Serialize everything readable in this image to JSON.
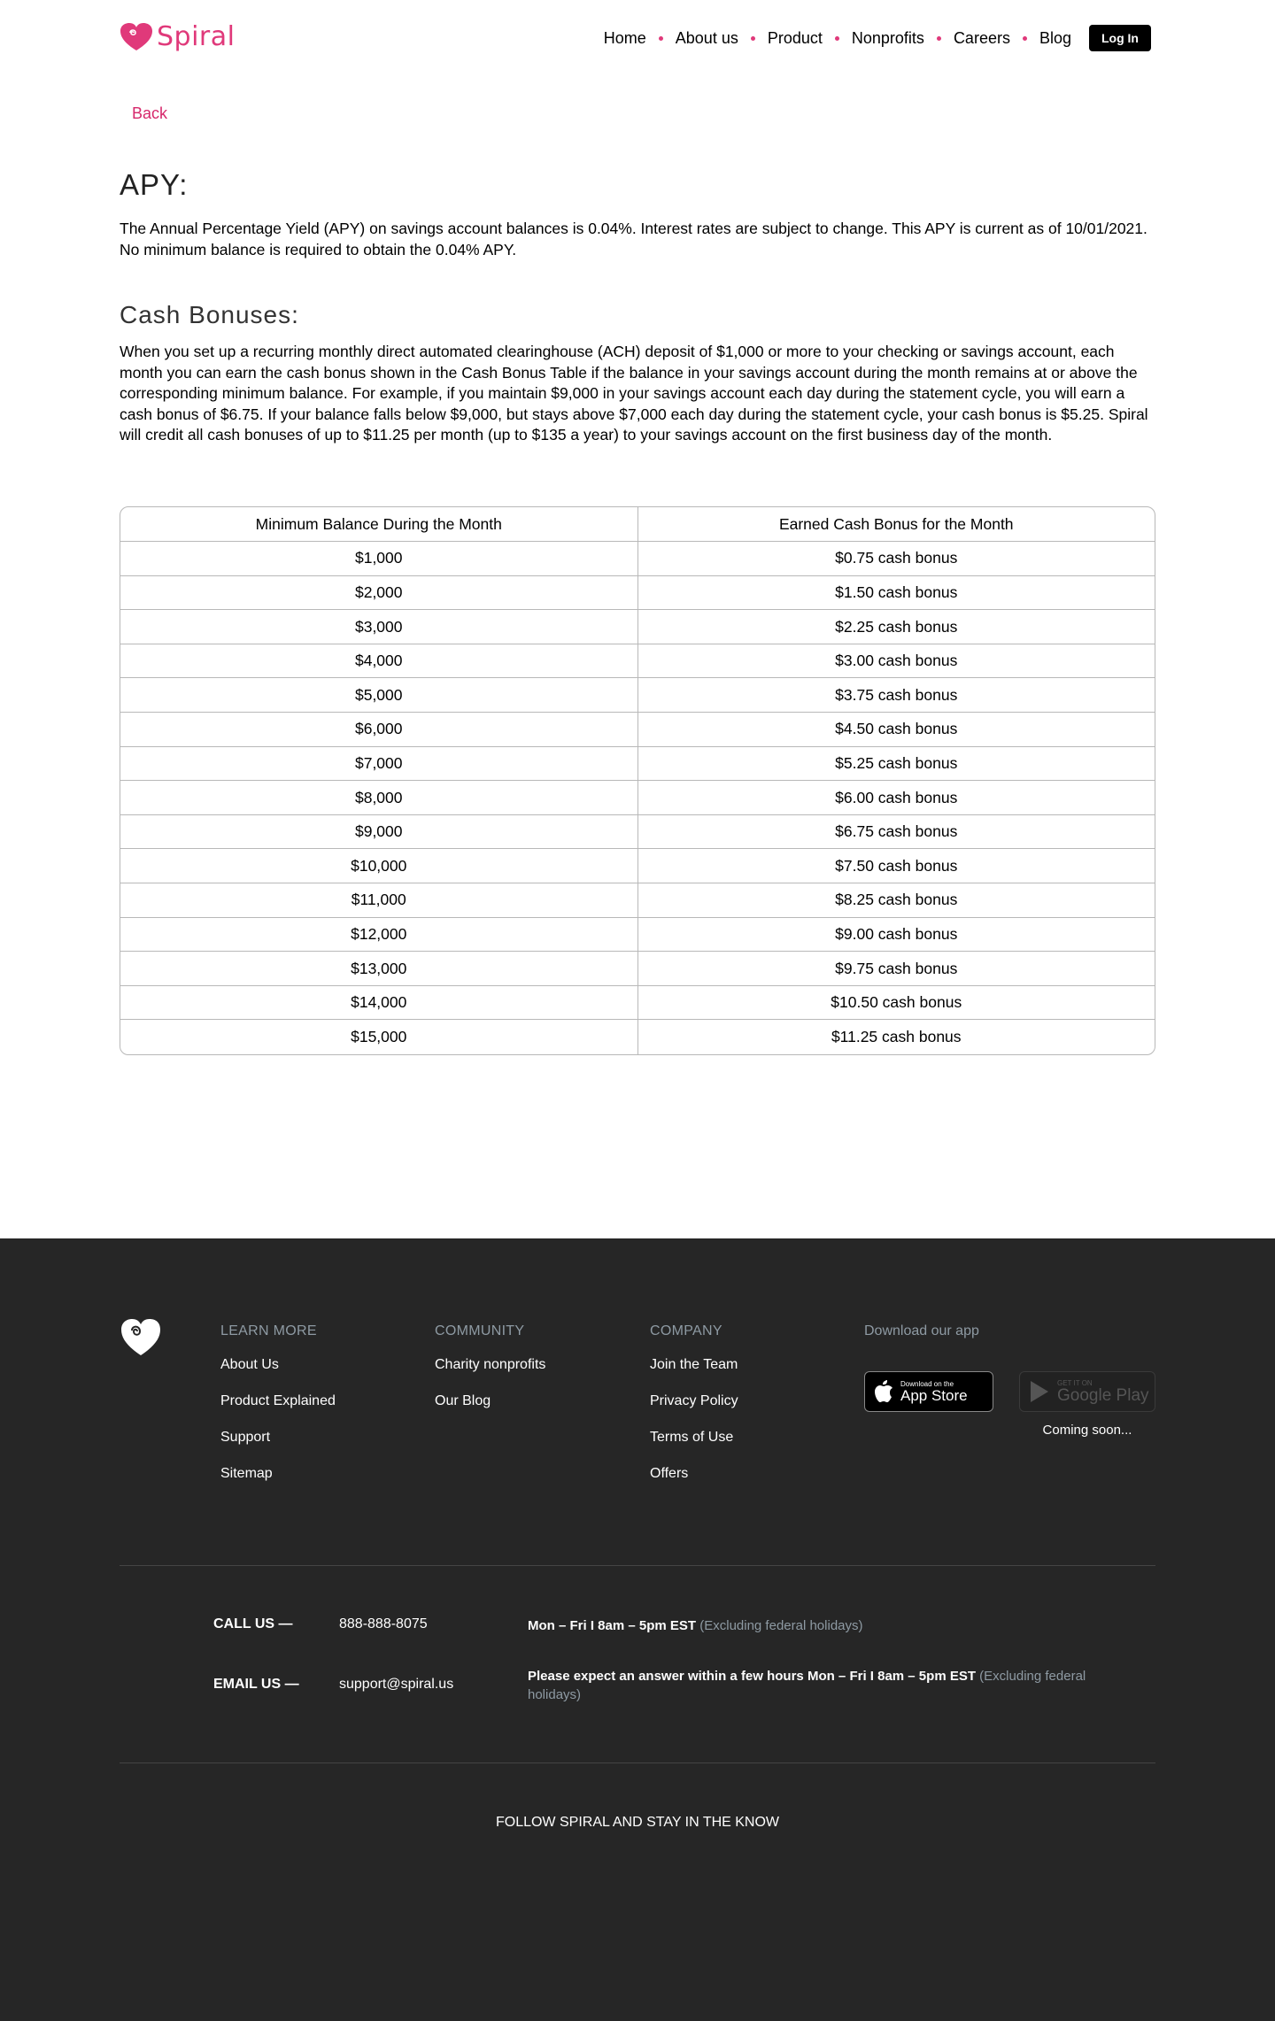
{
  "header": {
    "brand": "Spiral",
    "nav": [
      "Home",
      "About us",
      "Product",
      "Nonprofits",
      "Careers",
      "Blog"
    ],
    "login": "Log In"
  },
  "back": "Back",
  "apy": {
    "title": "APY:",
    "text": "The Annual Percentage Yield (APY) on savings account balances is 0.04%. Interest rates are subject to change. This APY is current as of 10/01/2021. No minimum balance is required to obtain the 0.04% APY."
  },
  "cash": {
    "title": "Cash Bonuses:",
    "text": "When you set up a recurring monthly direct automated clearinghouse (ACH) deposit of $1,000 or more to your checking or savings account, each month you can earn the cash bonus shown in the Cash Bonus Table if the balance in your savings account during the month remains at or above the corresponding minimum balance. For example, if you maintain $9,000 in your savings account each day during the statement cycle, you will earn a cash bonus of $6.75. If your balance falls below $9,000, but stays above $7,000 each day during the statement cycle, your cash bonus is $5.25. Spiral will credit all cash bonuses of up to $11.25 per month (up to $135 a year) to your savings account on the first business day of the month."
  },
  "table": {
    "headers": [
      "Minimum Balance During the Month",
      "Earned Cash Bonus for the Month"
    ],
    "rows": [
      [
        "$1,000",
        "$0.75 cash bonus"
      ],
      [
        "$2,000",
        "$1.50 cash bonus"
      ],
      [
        "$3,000",
        "$2.25 cash bonus"
      ],
      [
        "$4,000",
        "$3.00 cash bonus"
      ],
      [
        "$5,000",
        "$3.75 cash bonus"
      ],
      [
        "$6,000",
        "$4.50 cash bonus"
      ],
      [
        "$7,000",
        "$5.25 cash bonus"
      ],
      [
        "$8,000",
        "$6.00 cash bonus"
      ],
      [
        "$9,000",
        "$6.75 cash bonus"
      ],
      [
        "$10,000",
        "$7.50 cash bonus"
      ],
      [
        "$11,000",
        "$8.25 cash bonus"
      ],
      [
        "$12,000",
        "$9.00 cash bonus"
      ],
      [
        "$13,000",
        "$9.75 cash bonus"
      ],
      [
        "$14,000",
        "$10.50 cash bonus"
      ],
      [
        "$15,000",
        "$11.25 cash bonus"
      ]
    ]
  },
  "footer": {
    "learn_more": {
      "title": "LEARN MORE",
      "links": [
        "About Us",
        "Product Explained",
        "Support",
        "Sitemap"
      ]
    },
    "community": {
      "title": "COMMUNITY",
      "links": [
        "Charity nonprofits",
        "Our Blog"
      ]
    },
    "company": {
      "title": "COMPANY",
      "links": [
        "Join the Team",
        "Privacy Policy",
        "Terms of Use",
        "Offers"
      ]
    },
    "app": {
      "title": "Download our app",
      "appstore_small": "Download on the",
      "appstore_big": "App Store",
      "google_small": "GET IT ON",
      "google_big": "Google Play",
      "coming_soon": "Coming soon..."
    },
    "call": {
      "label": "CALL US —",
      "value": "888-888-8075",
      "hours": "Mon – Fri I 8am – 5pm EST",
      "note": "(Excluding federal holidays)"
    },
    "email": {
      "label": "EMAIL US —",
      "value": "support@spiral.us",
      "hours": "Please expect an answer within a few hours Mon – Fri I 8am – 5pm EST",
      "note": "(Excluding federal holidays)"
    },
    "follow": "FOLLOW SPIRAL AND STAY IN THE KNOW"
  },
  "colors": {
    "brand": "#e0397a",
    "footer_bg": "#262626",
    "muted": "#8e9aa3"
  }
}
